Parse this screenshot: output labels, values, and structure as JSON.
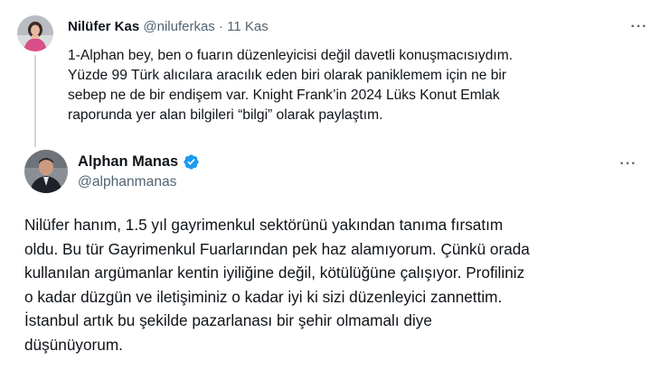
{
  "parent_tweet": {
    "author_name": "Nilüfer Kas",
    "author_handle": "@niluferkas",
    "separator": "·",
    "date": "11 Kas",
    "more_label": "···",
    "text_lines": [
      "1-Alphan bey, ben o fuarın düzenleyicisi değil davetli konuşmacısıydım.",
      "Yüzde 99 Türk alıcılara aracılık eden biri olarak paniklemem için ne bir",
      "sebep ne de bir endişem var.  Knight Frank’in  2024 Lüks Konut Emlak",
      "raporunda yer alan bilgileri “bilgi” olarak paylaştım."
    ]
  },
  "reply_tweet": {
    "author_name": "Alphan Manas",
    "author_handle": "@alphanmanas",
    "verified_icon": "verified-badge-icon",
    "more_label": "···",
    "text_lines": [
      "Nilüfer hanım, 1.5 yıl gayrimenkul sektörünü yakından tanıma fırsatım",
      "oldu. Bu tür Gayrimenkul Fuarlarından pek haz alamıyorum. Çünkü orada",
      "kullanılan argümanlar kentin iyiliğine değil, kötülüğüne çalışıyor. Profiliniz",
      "o kadar düzgün ve iletişiminiz o kadar iyi ki sizi düzenleyici zannettim.",
      "İstanbul artık bu şekilde pazarlanası bir şehir olmamalı diye",
      "düşünüyorum."
    ]
  },
  "colors": {
    "text_primary": "#0f1419",
    "text_secondary": "#536471",
    "thread_line": "#cfd9de",
    "verified_blue": "#1d9bf0"
  }
}
